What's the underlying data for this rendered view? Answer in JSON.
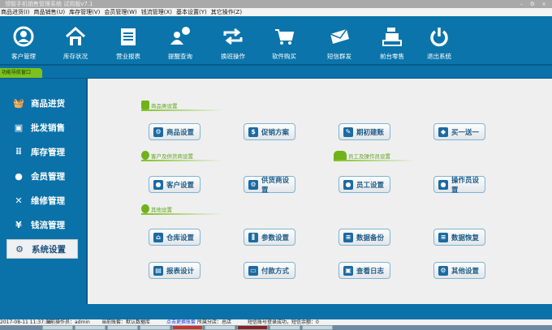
{
  "window": {
    "title": "领智手机销售管理系统 试用版v7.1",
    "controls": "– ⚙ ×"
  },
  "menu": [
    "商品进货(I)",
    "商品销售(U)",
    "库存管理(V)",
    "会员管理(W)",
    "钱流管理(X)",
    "基本设置(Y)",
    "其它操作(Z)"
  ],
  "toolbar": [
    {
      "label": "客户管理",
      "icon": "user-circle-icon"
    },
    {
      "label": "库存状况",
      "icon": "house-icon"
    },
    {
      "label": "营业报表",
      "icon": "notepad-icon"
    },
    {
      "label": "提醒查询",
      "icon": "chat-user-icon"
    },
    {
      "label": "换班操作",
      "icon": "swap-arrows-icon"
    },
    {
      "label": "软件购买",
      "icon": "cart-icon"
    },
    {
      "label": "短信群发",
      "icon": "envelope-icon"
    },
    {
      "label": "前台零售",
      "icon": "cash-register-icon"
    },
    {
      "label": "退出系统",
      "icon": "power-icon"
    }
  ],
  "nav_tab": "功能导航窗口",
  "sidebar": [
    {
      "label": "商品进货",
      "icon": "basket-icon"
    },
    {
      "label": "批发销售",
      "icon": "invoice-icon"
    },
    {
      "label": "库存管理",
      "icon": "grid-icon"
    },
    {
      "label": "会员管理",
      "icon": "person-icon"
    },
    {
      "label": "维修管理",
      "icon": "tools-icon"
    },
    {
      "label": "钱流管理",
      "icon": "yen-icon"
    },
    {
      "label": "系统设置",
      "icon": "gear-icon",
      "selected": true
    }
  ],
  "sections": {
    "goods": "商品类设置",
    "customer": "客户及供货商设置",
    "staff": "员工及操作员设置",
    "other": "其他设置"
  },
  "buttons": {
    "goods": [
      "商品设置",
      "促销方案",
      "期初建账",
      "买一送一"
    ],
    "people": [
      "客户设置",
      "供货商设置",
      "员工设置",
      "操作员设置"
    ],
    "other1": [
      "仓库设置",
      "参数设置",
      "数据备份",
      "数据恢复"
    ],
    "other2": [
      "报表设计",
      "付款方式",
      "查看日志",
      "其他设置"
    ]
  },
  "status": {
    "datetime": "2017-08-11 11:37:36",
    "operator": "当前操作员：admin",
    "account": "当前账套：默认数据库",
    "switch_link": "点击更换账套",
    "branch": "所属分店：总店",
    "sms": "短信账号登录成功，短信余额：0"
  }
}
